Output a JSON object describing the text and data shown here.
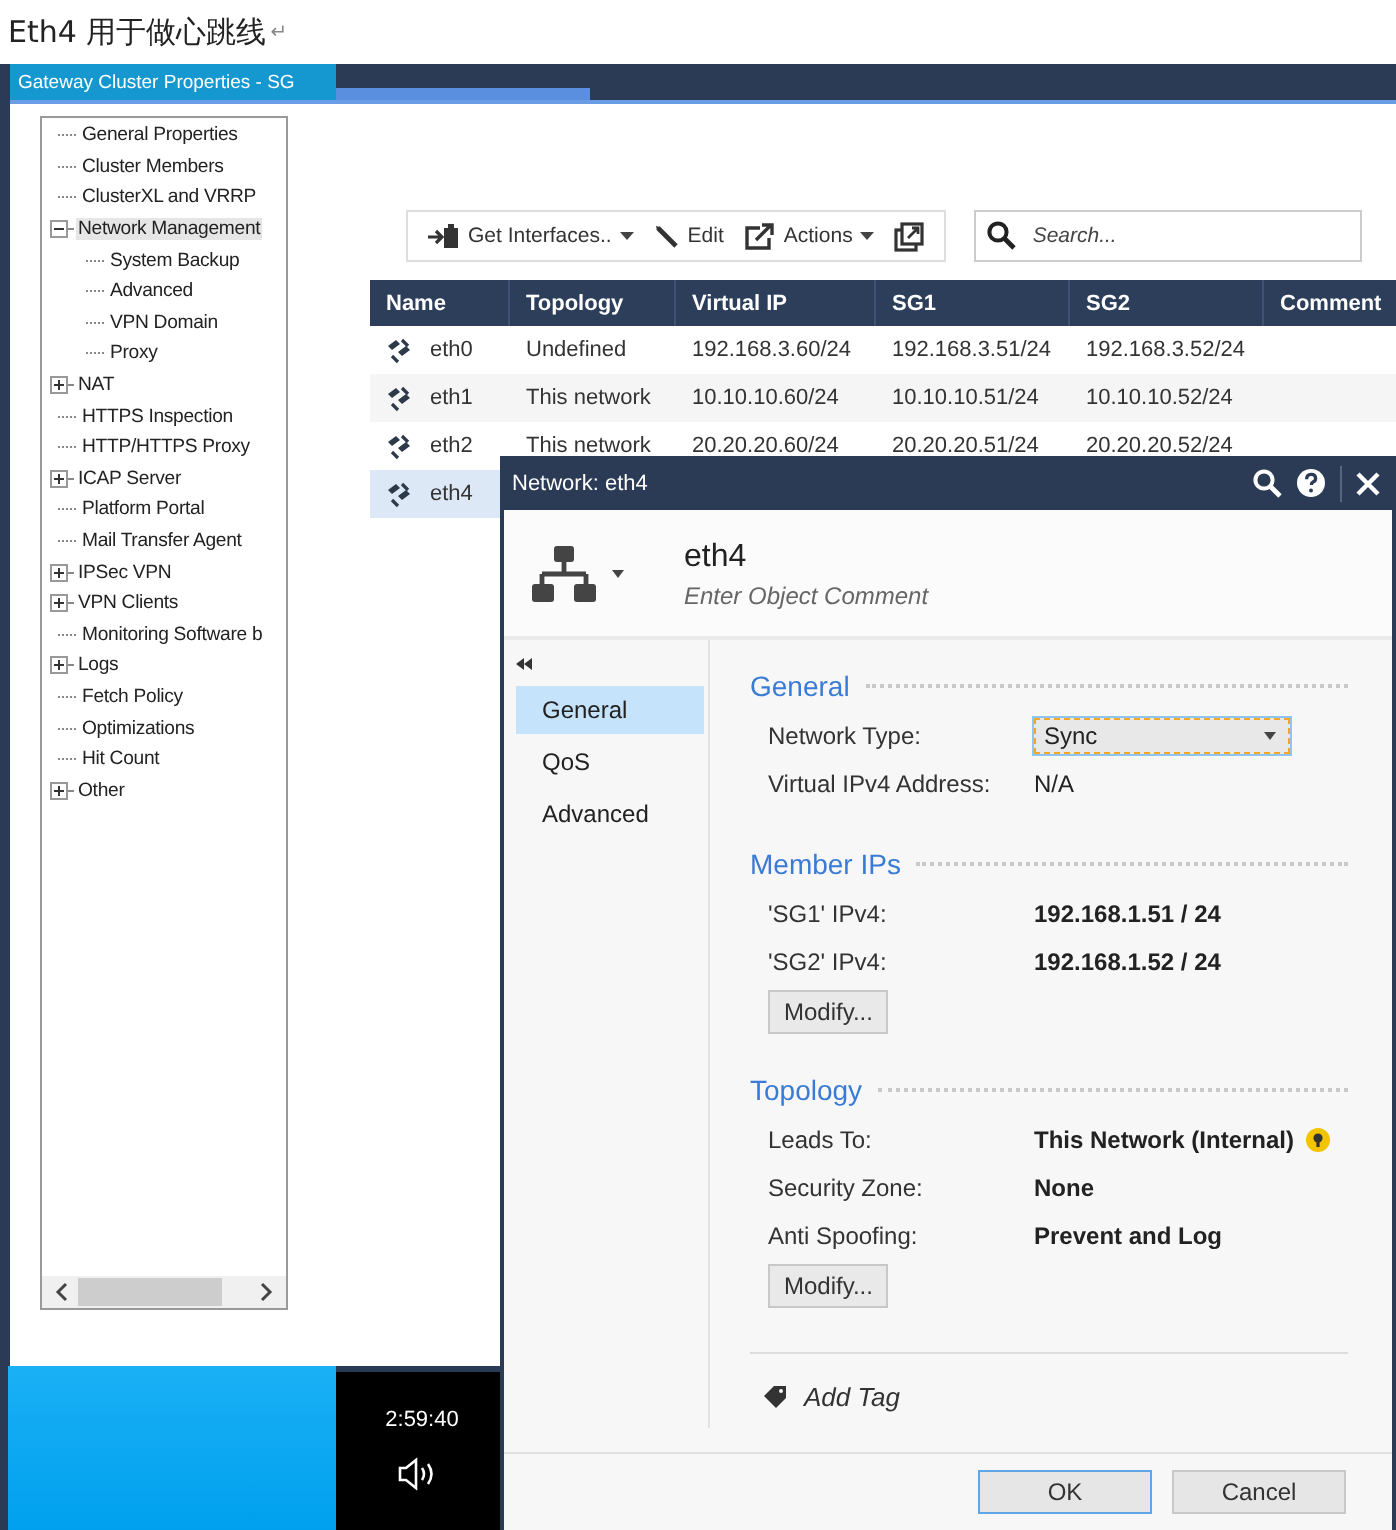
{
  "caption": {
    "text": "Eth4 用于做心跳线",
    "mark": "↵"
  },
  "window": {
    "title": "Gateway Cluster Properties - SG"
  },
  "tree": [
    {
      "label": "General Properties",
      "selected": false
    },
    {
      "label": "Cluster Members",
      "selected": false
    },
    {
      "label": "ClusterXL and VRRP",
      "selected": false
    },
    {
      "label": "Network Management",
      "selected": true,
      "expanded": true,
      "children": [
        {
          "label": "System Backup",
          "selected": false
        },
        {
          "label": "Advanced",
          "selected": false
        },
        {
          "label": "VPN Domain",
          "selected": false
        },
        {
          "label": "Proxy",
          "selected": false
        }
      ]
    },
    {
      "label": "NAT",
      "selected": false,
      "expanded": false
    },
    {
      "label": "HTTPS Inspection",
      "selected": false
    },
    {
      "label": "HTTP/HTTPS Proxy",
      "selected": false
    },
    {
      "label": "ICAP Server",
      "selected": false,
      "expanded": false
    },
    {
      "label": "Platform Portal",
      "selected": false
    },
    {
      "label": "Mail Transfer Agent",
      "selected": false
    },
    {
      "label": "IPSec VPN",
      "selected": false,
      "expanded": false
    },
    {
      "label": "VPN Clients",
      "selected": false,
      "expanded": false
    },
    {
      "label": "Monitoring Software b",
      "selected": false
    },
    {
      "label": "Logs",
      "selected": false,
      "expanded": false
    },
    {
      "label": "Fetch Policy",
      "selected": false
    },
    {
      "label": "Optimizations",
      "selected": false
    },
    {
      "label": "Hit Count",
      "selected": false
    },
    {
      "label": "Other",
      "selected": false,
      "expanded": false
    }
  ],
  "toolbar": [
    {
      "kind": "get-interfaces",
      "label": "Get Interfaces..",
      "dropdown": true
    },
    {
      "kind": "edit",
      "label": "Edit",
      "dropdown": false
    },
    {
      "kind": "actions",
      "label": "Actions",
      "dropdown": true
    },
    {
      "kind": "popout"
    }
  ],
  "search": {
    "placeholder": "Search..."
  },
  "table": {
    "columns": [
      "Name",
      "Topology",
      "Virtual IP",
      "SG1",
      "SG2",
      "Comment"
    ],
    "rows": [
      {
        "selected": false,
        "cells": [
          "eth0",
          "Undefined",
          "192.168.3.60/24",
          "192.168.3.51/24",
          "192.168.3.52/24"
        ]
      },
      {
        "selected": false,
        "cells": [
          "eth1",
          "This network",
          "10.10.10.60/24",
          "10.10.10.51/24",
          "10.10.10.52/24"
        ]
      },
      {
        "selected": false,
        "cells": [
          "eth2",
          "This network",
          "20.20.20.60/24",
          "20.20.20.51/24",
          "20.20.20.52/24"
        ]
      },
      {
        "selected": true,
        "cells": [
          "eth4"
        ]
      }
    ]
  },
  "dialog": {
    "title": "Network: eth4",
    "name": "eth4",
    "comment_placeholder": "Enter Object Comment",
    "nav": [
      {
        "label": "General",
        "selected": true
      },
      {
        "label": "QoS",
        "selected": false
      },
      {
        "label": "Advanced",
        "selected": false
      }
    ],
    "sections": [
      {
        "title": "General",
        "rows": [
          {
            "kind": "select",
            "label": "Network Type:",
            "value": "Sync"
          },
          {
            "kind": "plain",
            "label": "Virtual IPv4 Address:",
            "value": "N/A"
          }
        ]
      },
      {
        "title": "Member IPs",
        "rows": [
          {
            "kind": "bold",
            "label": "'SG1' IPv4:",
            "value": "192.168.1.51 / 24"
          },
          {
            "kind": "bold",
            "label": "'SG2' IPv4:",
            "value": "192.168.1.52 / 24"
          }
        ],
        "button": "Modify..."
      },
      {
        "title": "Topology",
        "rows": [
          {
            "kind": "bold-hint",
            "label": "Leads To:",
            "value": "This Network (Internal)"
          },
          {
            "kind": "bold",
            "label": "Security Zone:",
            "value": "None"
          },
          {
            "kind": "bold",
            "label": "Anti Spoofing:",
            "value": "Prevent and Log"
          }
        ],
        "button": "Modify..."
      }
    ],
    "add_tag": "Add Tag",
    "buttons": [
      "OK",
      "Cancel"
    ]
  },
  "taskbar": {
    "time": "2:59:40"
  }
}
